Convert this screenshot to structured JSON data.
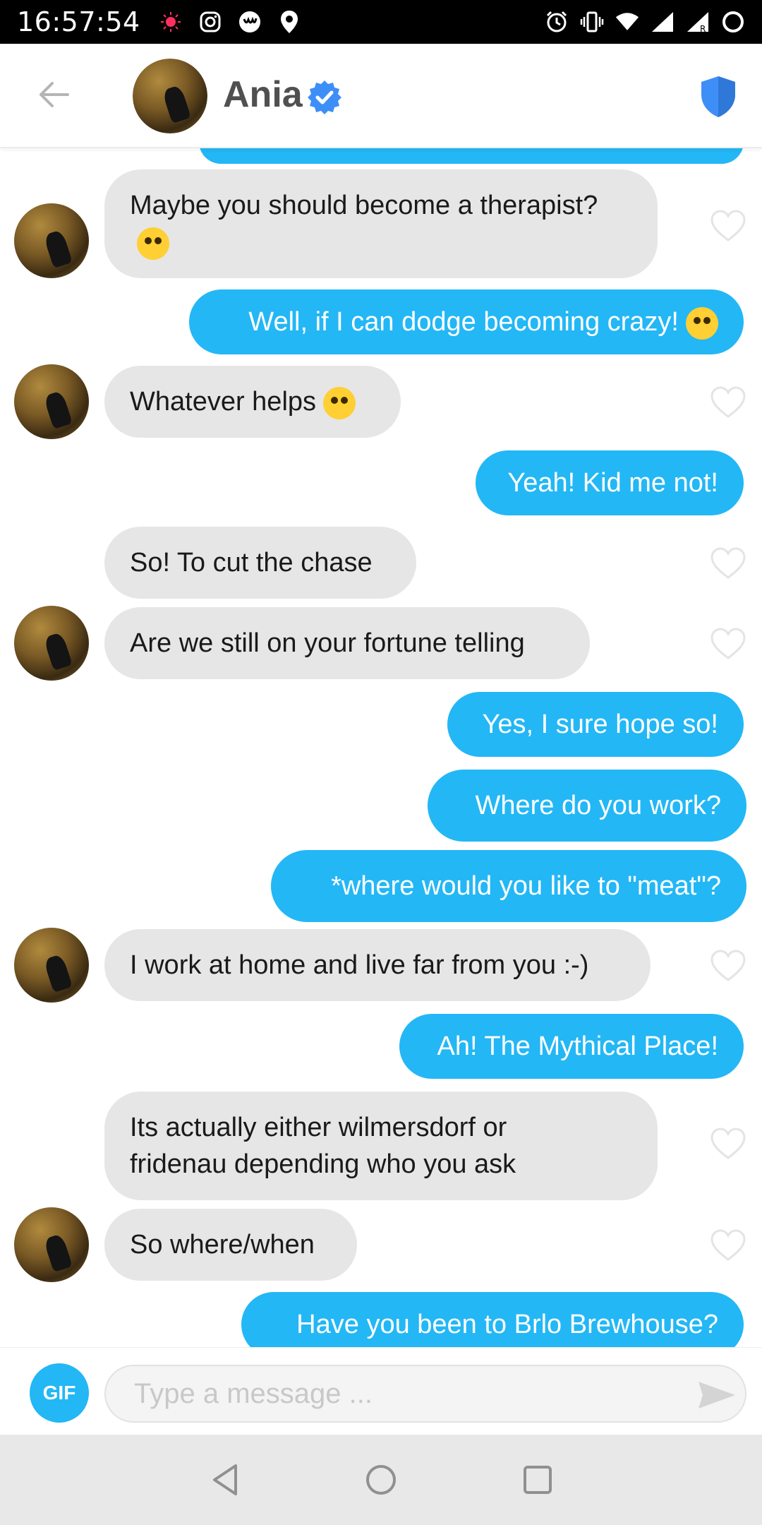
{
  "status_bar": {
    "time": "16:57:54",
    "left_icons": [
      "record-icon",
      "instagram-icon",
      "app-icon",
      "location-icon"
    ],
    "right_icons": [
      "alarm-icon",
      "vibrate-icon",
      "wifi-icon",
      "signal-icon",
      "signal-roaming-icon",
      "battery-icon"
    ]
  },
  "header": {
    "name": "Ania",
    "verified": true,
    "accent": "#3e8ef7"
  },
  "messages": [
    {
      "dir": "in",
      "text": "Maybe you should become a therapist?",
      "emoji": "nerd-face",
      "avatar": true
    },
    {
      "dir": "out",
      "text": "Well, if I can dodge becoming crazy!",
      "emoji": "rofl"
    },
    {
      "dir": "in",
      "text": "Whatever helps",
      "emoji": "zany-face",
      "avatar": true
    },
    {
      "dir": "out",
      "text": "Yeah! Kid me not!"
    },
    {
      "dir": "in",
      "text": "So! To cut the chase",
      "avatar": false
    },
    {
      "dir": "in",
      "text": "Are we still on your fortune telling",
      "avatar": true
    },
    {
      "dir": "out",
      "text": "Yes, I sure hope so!"
    },
    {
      "dir": "out",
      "text": "Where do you work?"
    },
    {
      "dir": "out",
      "text": "*where would you like to \"meat\"?"
    },
    {
      "dir": "in",
      "text": "I work at home and live far from you :-)",
      "avatar": true
    },
    {
      "dir": "out",
      "text": "Ah! The Mythical Place!"
    },
    {
      "dir": "in",
      "text": "Its actually either wilmersdorf or fridenau depending who you ask",
      "avatar": false
    },
    {
      "dir": "in",
      "text": "So where/when",
      "avatar": true
    },
    {
      "dir": "out",
      "text": "Have you been to Brlo Brewhouse?"
    }
  ],
  "composer": {
    "gif_label": "GIF",
    "placeholder": "Type a message ..."
  },
  "colors": {
    "outgoing": "#23b7f5",
    "incoming": "#e6e6e6",
    "status_bar": "#000000"
  }
}
